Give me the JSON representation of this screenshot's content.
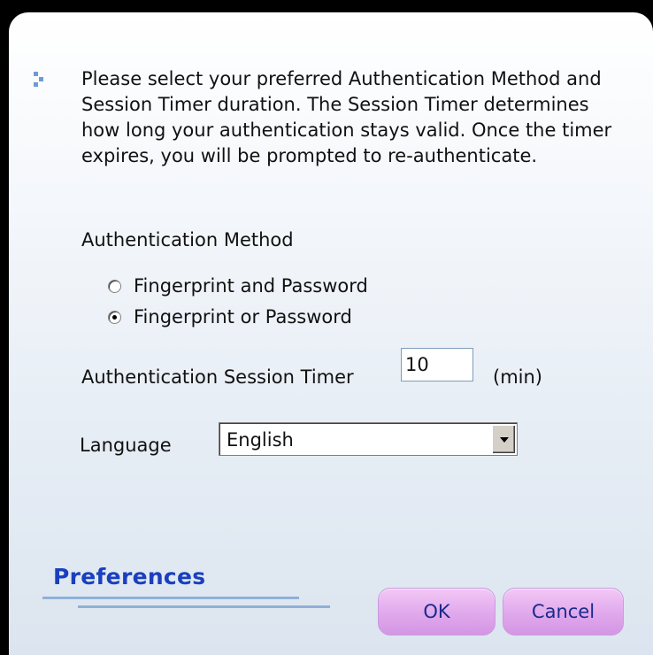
{
  "dialog": {
    "description": "Please select your preferred Authentication Method and Session Timer duration. The Session Timer determines how long your authentication stays valid. Once the timer expires, you will be prompted to re-authenticate.",
    "auth_method_label": "Authentication Method",
    "auth_options": [
      {
        "label": "Fingerprint and Password",
        "selected": false
      },
      {
        "label": "Fingerprint or Password",
        "selected": true
      }
    ],
    "timer_label": "Authentication Session Timer",
    "timer_value": "10",
    "timer_unit": "(min)",
    "language_label": "Language",
    "language_selected": "English"
  },
  "footer": {
    "brand_title": "Preferences",
    "ok_label": "OK",
    "cancel_label": "Cancel"
  },
  "colors": {
    "brand_title": "#1a3fbf",
    "button_fill": "#e0a8ec",
    "button_text": "#1a2a8c",
    "accent_line": "#8fb0d8"
  }
}
